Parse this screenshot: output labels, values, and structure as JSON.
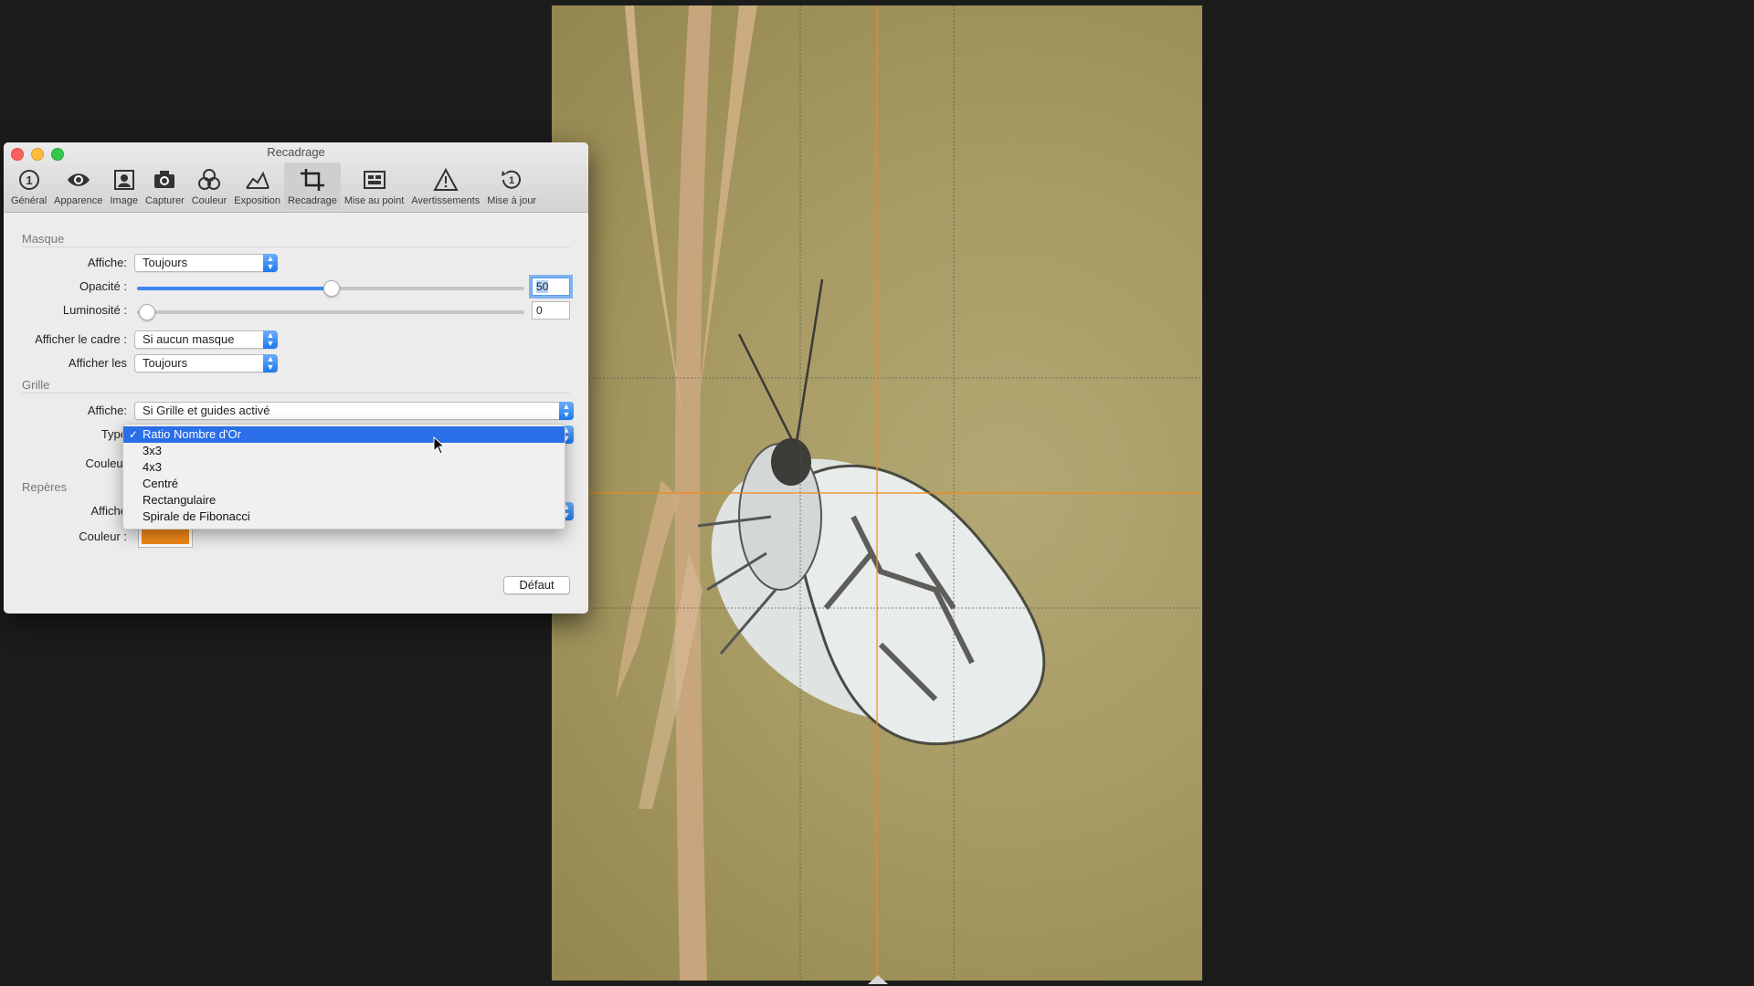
{
  "window": {
    "title": "Recadrage"
  },
  "toolbar": {
    "items": [
      {
        "label": "Général",
        "icon": "general-icon"
      },
      {
        "label": "Apparence",
        "icon": "eye-icon"
      },
      {
        "label": "Image",
        "icon": "portrait-image-icon"
      },
      {
        "label": "Capturer",
        "icon": "camera-icon"
      },
      {
        "label": "Couleur",
        "icon": "color-circles-icon"
      },
      {
        "label": "Exposition",
        "icon": "exposure-icon"
      },
      {
        "label": "Recadrage",
        "icon": "crop-icon",
        "selected": true
      },
      {
        "label": "Mise au point",
        "icon": "focus-icon"
      },
      {
        "label": "Avertissements",
        "icon": "warning-icon"
      },
      {
        "label": "Mise à jour",
        "icon": "update-icon"
      }
    ]
  },
  "masque": {
    "title": "Masque",
    "affiche_label": "Affiche:",
    "affiche_value": "Toujours",
    "opacite_label": "Opacité :",
    "opacite_value": "50",
    "opacite_fraction": 0.5,
    "luminosite_label": "Luminosité :",
    "luminosite_value": "0",
    "luminosite_fraction": 0.0,
    "cadre_label": "Afficher le cadre :",
    "cadre_value": "Si aucun masque",
    "afficher_les_label": "Afficher les",
    "afficher_les_value": "Toujours"
  },
  "grille": {
    "title": "Grille",
    "affiche_label": "Affiche:",
    "affiche_value": "Si Grille et guides activé",
    "type_label": "Type",
    "couleur_label": "Couleur"
  },
  "reperes": {
    "title": "Repères",
    "affiche_label": "Affiche",
    "couleur_label": "Couleur :",
    "couleur_value": "#f28a1a"
  },
  "buttons": {
    "default": "Défaut"
  },
  "type_menu": {
    "options": [
      "Ratio Nombre d'Or",
      "3x3",
      "4x3",
      "Centré",
      "Rectangulaire",
      "Spirale de Fibonacci"
    ],
    "selected": "Ratio Nombre d'Or"
  },
  "colors": {
    "accent": "#2a6ee8",
    "guide": "#f28a1a"
  }
}
